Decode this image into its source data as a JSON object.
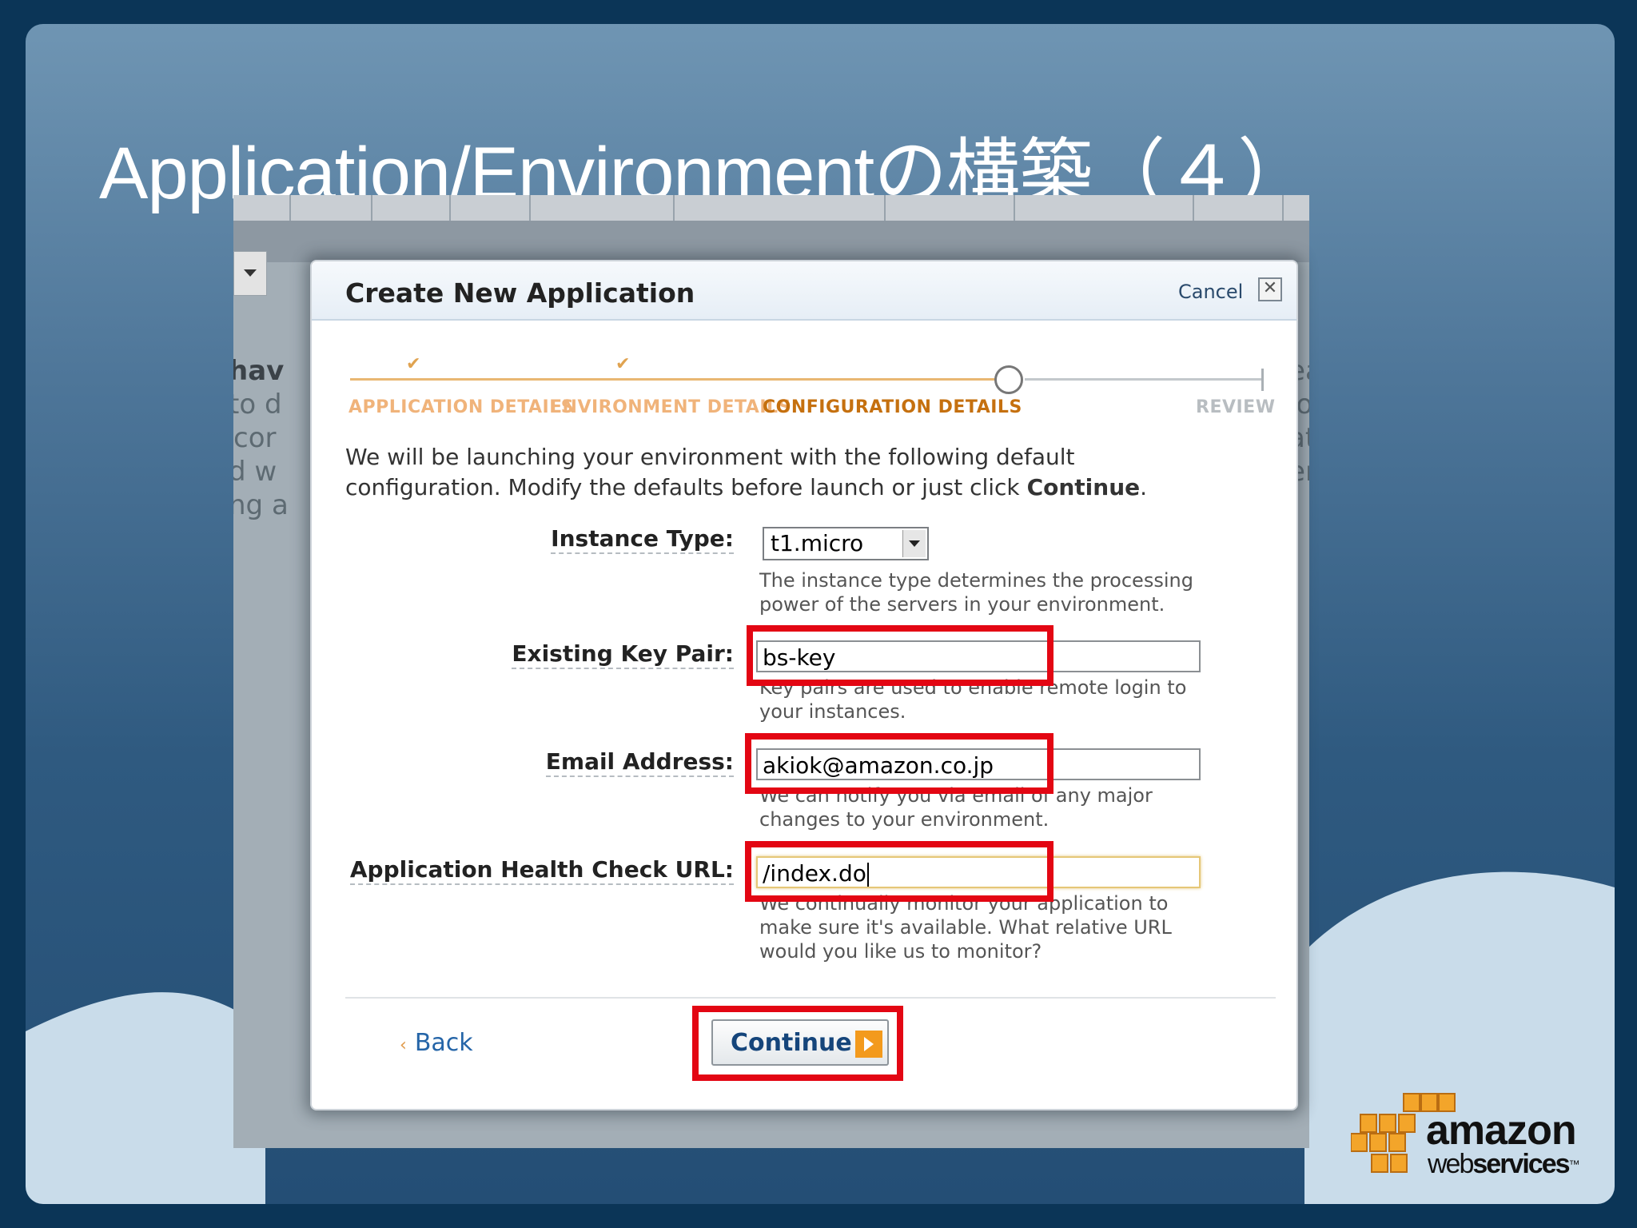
{
  "slide": {
    "title": "Application/Environmentの構築（４）"
  },
  "background_window": {
    "left_fragments": [
      "hav",
      "to d",
      "cor",
      "d w",
      "ng a"
    ],
    "right_fragments": [
      "ean",
      "lou",
      "atic",
      "ervi"
    ]
  },
  "dialog": {
    "title": "Create New Application",
    "cancel_label": "Cancel",
    "close_glyph": "✕",
    "steps": [
      {
        "label": "APPLICATION DETAILS",
        "state": "done"
      },
      {
        "label": "ENVIRONMENT DETAILS",
        "state": "done"
      },
      {
        "label": "CONFIGURATION DETAILS",
        "state": "active"
      },
      {
        "label": "REVIEW",
        "state": "todo"
      }
    ],
    "check_glyph": "✔",
    "intro_line1": "We will be launching your environment with the following default",
    "intro_line2_prefix": "configuration. Modify the defaults before launch or just click ",
    "intro_line2_bold": "Continue",
    "intro_line2_suffix": ".",
    "instance_type": {
      "label": "Instance Type:",
      "value": "t1.micro",
      "help_line1": "The instance type determines the processing",
      "help_line2": "power of the servers in your environment."
    },
    "key_pair": {
      "label": "Existing Key Pair:",
      "value": "bs-key",
      "help_line1": "Key pairs are used to enable remote login to",
      "help_line2": "your instances."
    },
    "email": {
      "label": "Email Address:",
      "value": "akiok@amazon.co.jp",
      "help_line1": "We can notify you via email of any major",
      "help_line2": "changes to your environment."
    },
    "health_url": {
      "label": "Application Health Check URL:",
      "value": "/index.do",
      "help_line1": "We continually monitor your application to",
      "help_line2": "make sure it's available. What relative URL",
      "help_line3": "would you like us to monitor?"
    },
    "back_chevron": "‹",
    "back_label": "Back",
    "continue_label": "Continue"
  },
  "branding": {
    "logo_word": "amazon",
    "logo_sub_light": "web",
    "logo_sub_bold": "services",
    "logo_tm": "™"
  },
  "colors": {
    "highlight": "#e30613",
    "step_active": "#c5700f",
    "button_accent": "#f39a1d"
  }
}
